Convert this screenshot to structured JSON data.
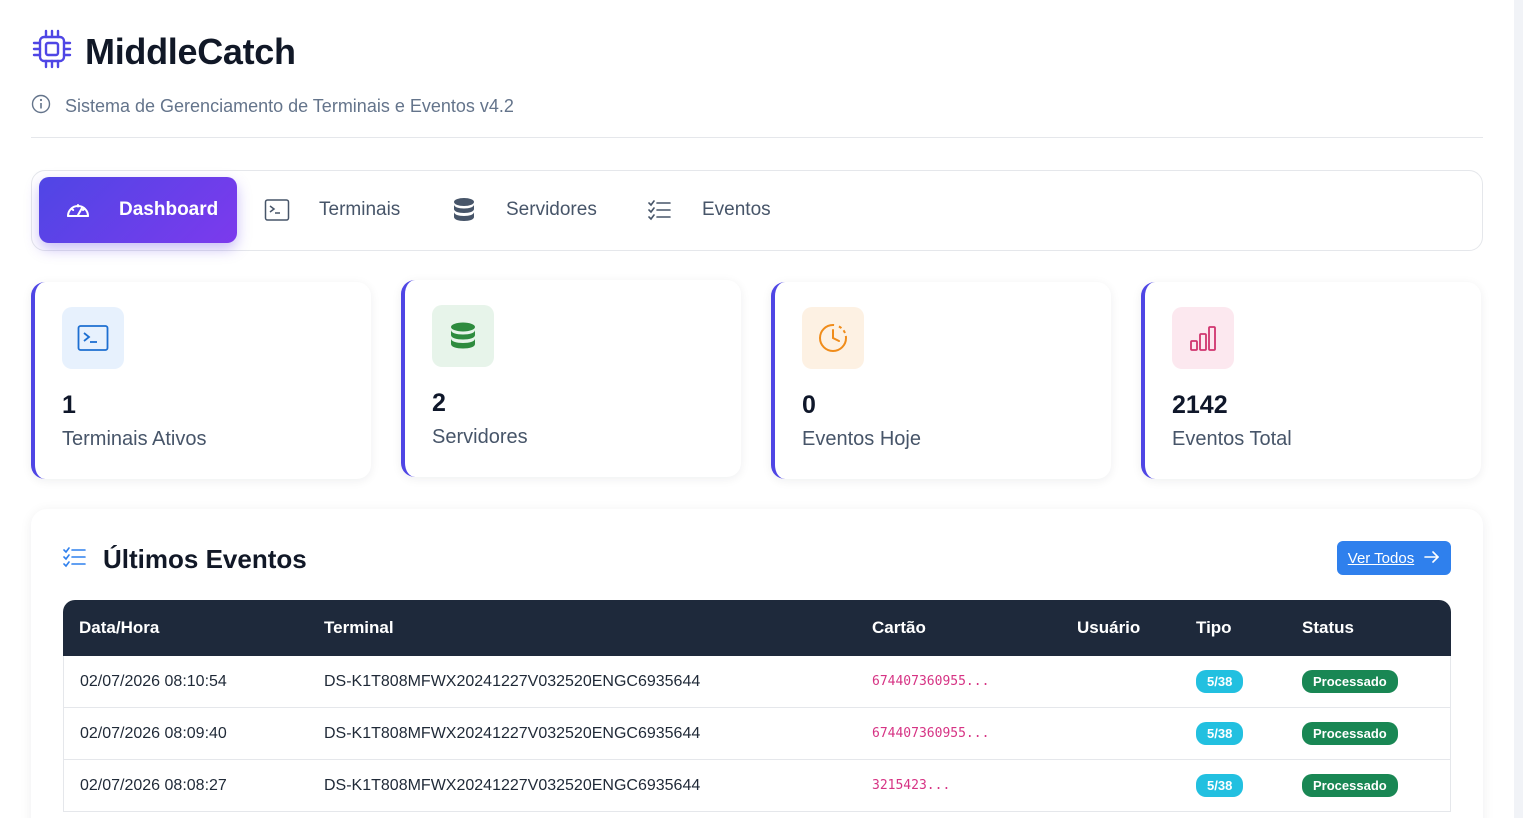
{
  "app": {
    "title": "MiddleCatch",
    "subtitle": "Sistema de Gerenciamento de Terminais e Eventos v4.2"
  },
  "nav": {
    "tabs": [
      {
        "label": "Dashboard",
        "icon": "speedometer-icon",
        "active": true
      },
      {
        "label": "Terminais",
        "icon": "terminal-icon",
        "active": false
      },
      {
        "label": "Servidores",
        "icon": "database-icon",
        "active": false
      },
      {
        "label": "Eventos",
        "icon": "list-check-icon",
        "active": false
      }
    ]
  },
  "stats": [
    {
      "value": "1",
      "label": "Terminais Ativos",
      "icon": "terminal-icon",
      "bg": "#e7f1fd",
      "fg": "#1d6fd1"
    },
    {
      "value": "2",
      "label": "Servidores",
      "icon": "database-icon",
      "bg": "#e7f4ea",
      "fg": "#2e8b3e"
    },
    {
      "value": "0",
      "label": "Eventos Hoje",
      "icon": "clock-icon",
      "bg": "#fdf1e3",
      "fg": "#f08c1a"
    },
    {
      "value": "2142",
      "label": "Eventos Total",
      "icon": "bar-chart-icon",
      "bg": "#fce8ef",
      "fg": "#d0346e"
    }
  ],
  "events": {
    "title": "Últimos Eventos",
    "view_all": "Ver Todos",
    "columns": [
      "Data/Hora",
      "Terminal",
      "Cartão",
      "Usuário",
      "Tipo",
      "Status"
    ],
    "rows": [
      {
        "datetime": "02/07/2026 08:10:54",
        "terminal": "DS-K1T808MFWX20241227V032520ENGC6935644",
        "card": "674407360955...",
        "user": "",
        "type": "5/38",
        "status": "Processado"
      },
      {
        "datetime": "02/07/2026 08:09:40",
        "terminal": "DS-K1T808MFWX20241227V032520ENGC6935644",
        "card": "674407360955...",
        "user": "",
        "type": "5/38",
        "status": "Processado"
      },
      {
        "datetime": "02/07/2026 08:08:27",
        "terminal": "DS-K1T808MFWX20241227V032520ENGC6935644",
        "card": "3215423...",
        "user": "",
        "type": "5/38",
        "status": "Processado"
      }
    ]
  },
  "colors": {
    "accent": "#4f46e5",
    "header_dark": "#1e293b",
    "button_blue": "#2f80ed",
    "type_badge": "#22c0e0",
    "status_badge": "#198754"
  }
}
